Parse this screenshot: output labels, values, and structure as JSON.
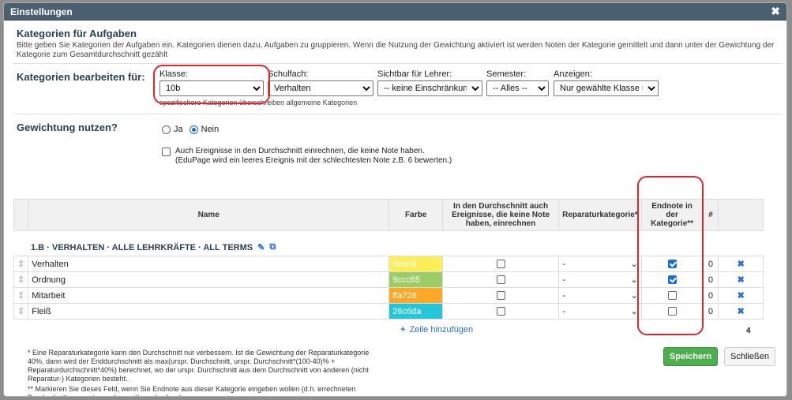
{
  "dialog": {
    "title": "Einstellungen",
    "close_icon": "close-icon"
  },
  "section": {
    "title": "Kategorien für Aufgaben",
    "description": "Bitte geben Sie Kategorien der Aufgaben ein. Kategorien dienen dazu, Aufgaben zu gruppieren. Wenn die Nutzung der Gewichtung aktiviert ist werden Noten der Kategorie gemittelt und dann unter der Gewichtung der Kategorie zum Gesamtdurchschnitt gezählt"
  },
  "filters": {
    "heading": "Kategorien bearbeiten für:",
    "klasse_label": "Klasse:",
    "klasse_value": "10b",
    "schulfach_label": "Schulfach:",
    "schulfach_value": "Verhalten",
    "sichtbar_label": "Sichtbar für Lehrer:",
    "sichtbar_value": "-- keine Einschränkung",
    "semester_label": "Semester:",
    "semester_value": "-- Alles --",
    "anzeigen_label": "Anzeigen:",
    "anzeigen_value": "Nur gewählte Klasse u",
    "note": "spezifischere Kategorien überschreiben allgemeine Kategorien"
  },
  "weighting": {
    "heading": "Gewichtung nutzen?",
    "ja_label": "Ja",
    "nein_label": "Nein",
    "selected": "Nein",
    "include_events_label": "Auch Ereignisse in den Durchschnitt einrechnen, die keine Note haben.",
    "include_events_sub": "(EduPage wird ein leeres Ereignis mit der schlechtesten Note z.B. 6 bewerten.)"
  },
  "table": {
    "headers": {
      "name": "Name",
      "farbe": "Farbe",
      "durchschnitt": "In den Durchschnitt auch Ereignisse, die keine Note haben, einrechnen",
      "reparatur": "Reparaturkategorie*",
      "endnote": "Endnote in der Kategorie**",
      "count": "#"
    },
    "group_label": "1.B · VERHALTEN · ALLE LEHRKRÄFTE · ALL TERMS",
    "rows": [
      {
        "name": "Verhalten",
        "color": "ffee58",
        "color_hex": "#ffee58",
        "repair": "-",
        "endnote": true,
        "count": "0"
      },
      {
        "name": "Ordnung",
        "color": "9ccc65",
        "color_hex": "#9ccc65",
        "repair": "-",
        "endnote": true,
        "count": "0"
      },
      {
        "name": "Mitarbeit",
        "color": "ffa726",
        "color_hex": "#ffa726",
        "repair": "-",
        "endnote": false,
        "count": "0"
      },
      {
        "name": "Fleiß",
        "color": "26c6da",
        "color_hex": "#26c6da",
        "repair": "-",
        "endnote": false,
        "count": "0"
      }
    ],
    "add_row_label": "Zeile hinzufügen",
    "total": "4"
  },
  "footnotes": {
    "note1": "* Eine Reparaturkategorie kann den Durchschnitt nur verbessern. Ist die Gewichtung der Reparaturkategorie 40%, dann wird der Enddurchschnitt als max(urspr. Durchschnitt, urspr. Durchschnitt*(100-40)% + Reparaturdurchschnitt*40%) berechnet, wo der urspr. Durchschnitt aus dem Durchschnitt von anderen (nicht Reparatur-) Kategorien besteht.",
    "note2": "** Markieren Sie dieses Feld, wenn Sie Endnote aus dieser Kategorie eingeben wollen (d.h. errechneten Durchschnitt zu ersetzen oder zu überschreiben)"
  },
  "buttons": {
    "save": "Speichern",
    "close": "Schließen"
  },
  "colors": {
    "titlebar": "#4a6070",
    "accent": "#1a6fd1",
    "save_button": "#4cae4c",
    "annotation": "#e0262c"
  }
}
